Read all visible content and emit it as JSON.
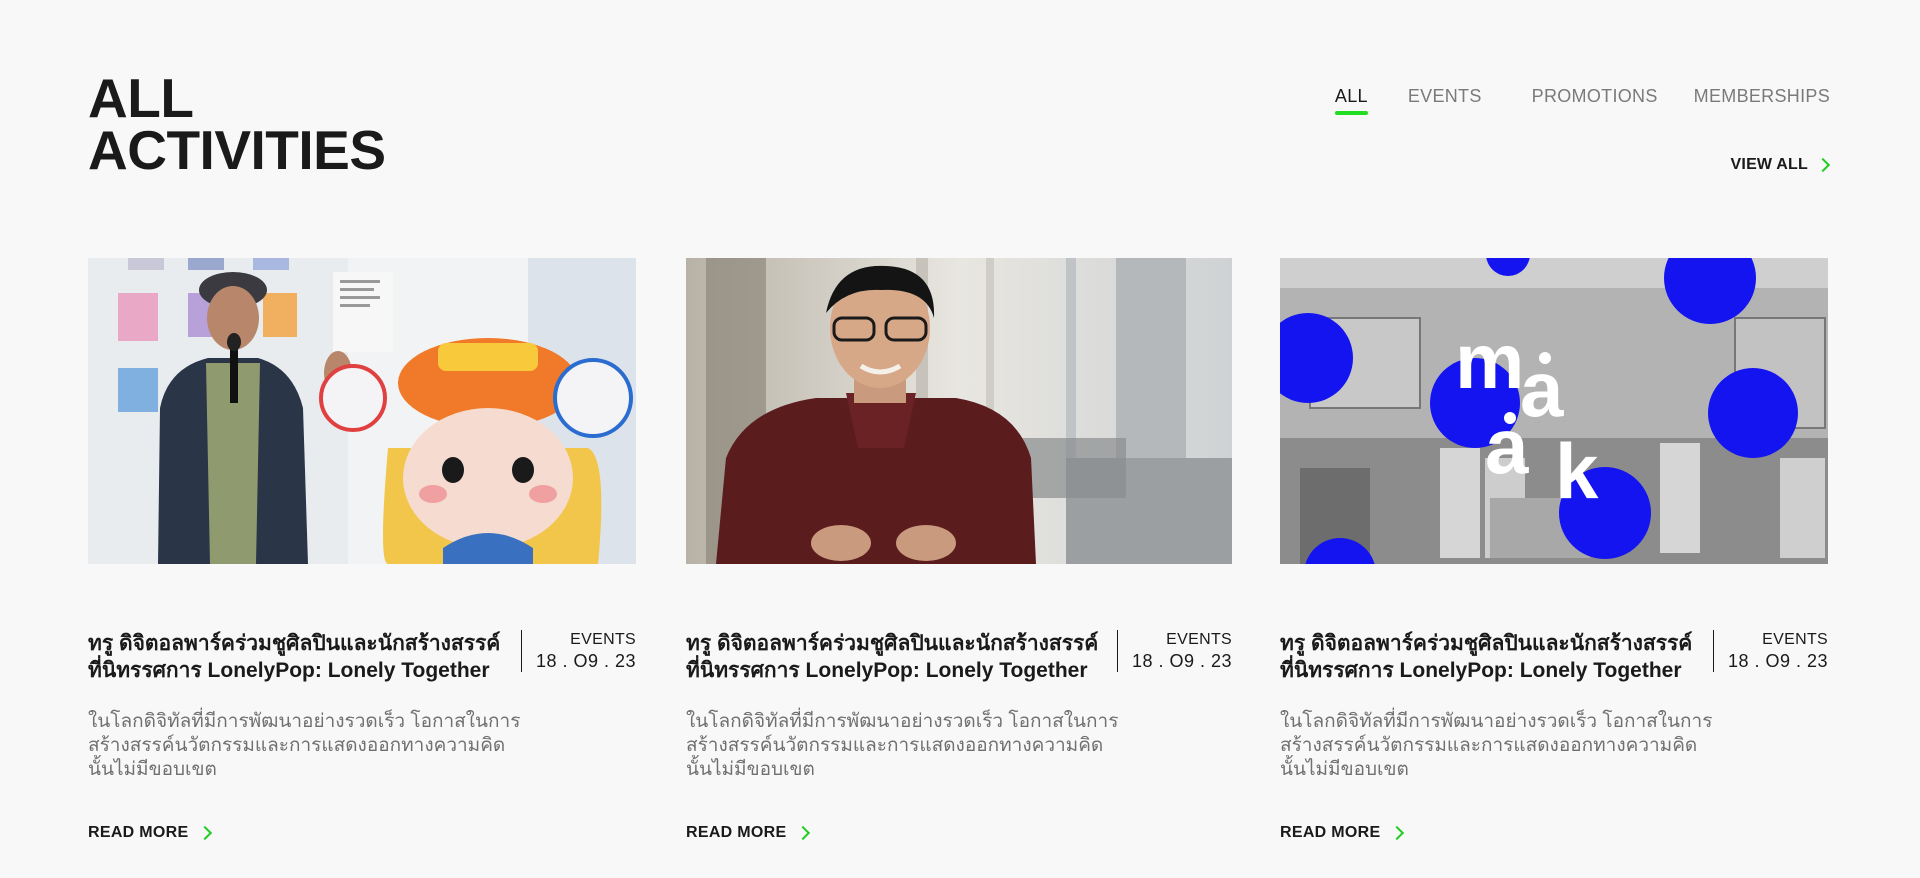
{
  "header": {
    "title_line1": "ALL",
    "title_line2": "ACTIVITIES",
    "tabs": [
      {
        "label": "ALL",
        "active": true
      },
      {
        "label": "EVENTS",
        "active": false
      },
      {
        "label": "PROMOTIONS",
        "active": false
      },
      {
        "label": "MEMBERSHIPS",
        "active": false
      }
    ],
    "view_all_label": "VIEW ALL"
  },
  "colors": {
    "accent": "#22dd22",
    "background": "#f8f8f8",
    "text": "#1a1a1a",
    "muted_text": "#707070",
    "blue_dots": "#1414f0"
  },
  "cards": [
    {
      "image_subject": "artist-with-figure-photo",
      "title": "ทรู ดิจิตอลพาร์คร่วมชูศิลปินและนักสร้างสรรค์ ที่นิทรรศการ LonelyPop: Lonely Together",
      "category": "EVENTS",
      "date": "18 . O9 . 23",
      "description": "ในโลกดิจิทัลที่มีการพัฒนาอย่างรวดเร็ว โอกาสในการสร้างสรรค์นวัตกรรมและการแสดงออกทางความคิดนั้นไม่มีขอบเขต",
      "read_more_label": "READ MORE"
    },
    {
      "image_subject": "man-interview-photo",
      "title": "ทรู ดิจิตอลพาร์คร่วมชูศิลปินและนักสร้างสรรค์ ที่นิทรรศการ LonelyPop: Lonely Together",
      "category": "EVENTS",
      "date": "18 . O9 . 23",
      "description": "ในโลกดิจิทัลที่มีการพัฒนาอย่างรวดเร็ว โอกาสในการสร้างสรรค์นวัตกรรมและการแสดงออกทางความคิดนั้นไม่มีขอบเขต",
      "read_more_label": "READ MORE"
    },
    {
      "image_subject": "makerspace-blue-dots-photo",
      "image_text": "mȧȧk",
      "title": "ทรู ดิจิตอลพาร์คร่วมชูศิลปินและนักสร้างสรรค์ ที่นิทรรศการ LonelyPop: Lonely Together",
      "category": "EVENTS",
      "date": "18 . O9 . 23",
      "description": "ในโลกดิจิทัลที่มีการพัฒนาอย่างรวดเร็ว โอกาสในการสร้างสรรค์นวัตกรรมและการแสดงออกทางความคิดนั้นไม่มีขอบเขต",
      "read_more_label": "READ MORE"
    }
  ]
}
